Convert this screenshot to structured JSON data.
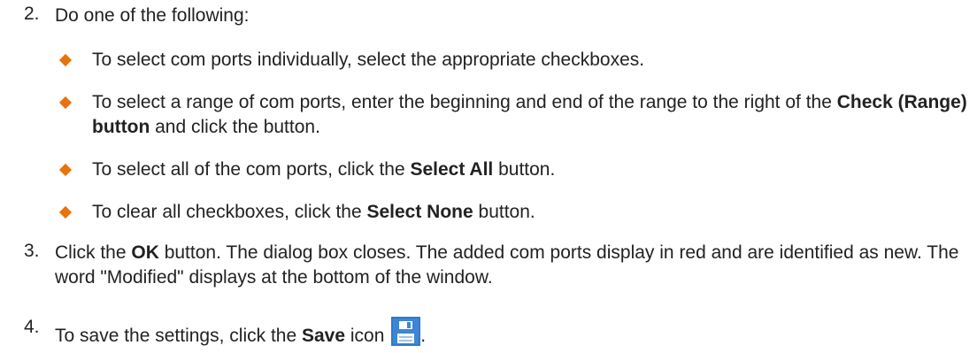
{
  "steps": [
    {
      "number": "2.",
      "text": "Do one of the following:"
    },
    {
      "number": "3.",
      "segments": [
        {
          "t": "Click the ",
          "b": false
        },
        {
          "t": "OK",
          "b": true
        },
        {
          "t": " button. The dialog box closes. The added com ports display in red and are identified as new. The word \"Modified\" displays at the bottom of the window.",
          "b": false
        }
      ]
    },
    {
      "number": "4.",
      "segments": [
        {
          "t": "To save the settings, click the ",
          "b": false
        },
        {
          "t": "Save",
          "b": true
        },
        {
          "t": " icon ",
          "b": false
        }
      ],
      "suffix": "."
    }
  ],
  "bullets": [
    {
      "segments": [
        {
          "t": "To select com ports individually, select the appropriate checkboxes.",
          "b": false
        }
      ]
    },
    {
      "segments": [
        {
          "t": "To select a range of com ports, enter the beginning and end of the range to the right of the ",
          "b": false
        },
        {
          "t": "Check (Range) button",
          "b": true
        },
        {
          "t": " and click the button.",
          "b": false
        }
      ]
    },
    {
      "segments": [
        {
          "t": "To select all of the com ports, click the ",
          "b": false
        },
        {
          "t": "Select All",
          "b": true
        },
        {
          "t": " button.",
          "b": false
        }
      ]
    },
    {
      "segments": [
        {
          "t": "To clear all checkboxes, click the ",
          "b": false
        },
        {
          "t": "Select None",
          "b": true
        },
        {
          "t": " button.",
          "b": false
        }
      ]
    }
  ],
  "colors": {
    "bullet": "#e8720c",
    "save_icon": "#3b86d6"
  },
  "icons": {
    "save": "floppy-disk-save-icon"
  }
}
